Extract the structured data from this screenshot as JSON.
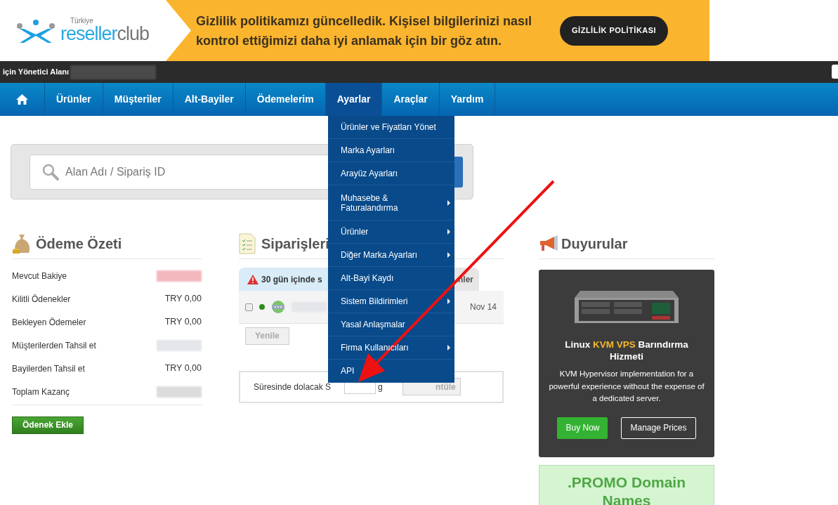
{
  "banner": {
    "logo_region": "Türkiye",
    "logo_brand": "reseller",
    "logo_brand_suffix": "club",
    "message_lines": [
      "Gizlilik politikamızı güncelledik. Kişisel bilgilerinizi nasıl",
      "kontrol ettiğimizi daha iyi anlamak için bir göz atın."
    ],
    "button": "GİZLİLİK POLİTİKASI"
  },
  "admin_bar": {
    "label": "için Yönetici Alanı"
  },
  "nav": [
    {
      "kind": "home",
      "selected": false
    },
    {
      "kind": "text",
      "label": "Ürünler",
      "selected": false
    },
    {
      "kind": "text",
      "label": "Müşteriler",
      "selected": false
    },
    {
      "kind": "text",
      "label": "Alt-Bayiler",
      "selected": false
    },
    {
      "kind": "text",
      "label": "Ödemelerim",
      "selected": false
    },
    {
      "kind": "text",
      "label": "Ayarlar",
      "selected": true
    },
    {
      "kind": "text",
      "label": "Araçlar",
      "selected": false
    },
    {
      "kind": "text",
      "label": "Yardım",
      "selected": false
    }
  ],
  "dropdown": [
    {
      "label": "Ürünler ve Fiyatları Yönet",
      "has_submenu": false
    },
    {
      "label": "Marka Ayarları",
      "has_submenu": false
    },
    {
      "label": "Arayüz Ayarları",
      "has_submenu": false
    },
    {
      "label": "Muhasebe & Faturalandırma",
      "has_submenu": true
    },
    {
      "label": "Ürünler",
      "has_submenu": true
    },
    {
      "label": "Diğer Marka Ayarları",
      "has_submenu": true
    },
    {
      "label": "Alt-Bayi Kaydı",
      "has_submenu": false
    },
    {
      "label": "Sistem Bildirimleri",
      "has_submenu": true
    },
    {
      "label": "Yasal Anlaşmalar",
      "has_submenu": false
    },
    {
      "label": "Firma Kullanıcıları",
      "has_submenu": true
    },
    {
      "label": "API",
      "has_submenu": false
    }
  ],
  "search": {
    "placeholder": "Alan Adı / Sipariş ID"
  },
  "payment_summary": {
    "title": "Ödeme Özeti",
    "rows": [
      {
        "label": "Mevcut Bakiye",
        "kind": "redacted",
        "color": "#f2b8bd"
      },
      {
        "label": "Kilitli Ödenekler",
        "kind": "value",
        "value": "TRY 0,00"
      },
      {
        "label": "Bekleyen Ödemeler",
        "kind": "value",
        "value": "TRY 0,00"
      },
      {
        "label": "Müşterilerden Tahsil et",
        "kind": "redacted",
        "color": "#e4e6ea"
      },
      {
        "label": "Bayilerden Tahsil et",
        "kind": "value",
        "value": "TRY 0,00"
      },
      {
        "label": "Toplam Kazanç",
        "kind": "redacted",
        "color": "#dcdcdc"
      }
    ],
    "button": "Ödenek Ekle"
  },
  "orders": {
    "title": "Siparişleri",
    "tab_left": "30 gün içinde s",
    "tab_right": "nler",
    "row": {
      "checked": false,
      "color": "#2e8b1e",
      "date": "Nov 14"
    },
    "refresh_button": "Yenile",
    "expiry": {
      "label": "Süresinde dolacak S",
      "suffix": "g",
      "button": "ntüle"
    }
  },
  "announcements": {
    "title": "Duyurular",
    "promo": {
      "title": "Linux",
      "highlight": "KVM VPS",
      "title_rest": "Barındırma Hizmeti",
      "description": "KVM Hypervisor implementation for a powerful experience without the expense of a dedicated server.",
      "buy_button": "Buy Now",
      "manage_button": "Manage Prices"
    },
    "promo2": {
      "title": ".PROMO Domain Names"
    }
  }
}
